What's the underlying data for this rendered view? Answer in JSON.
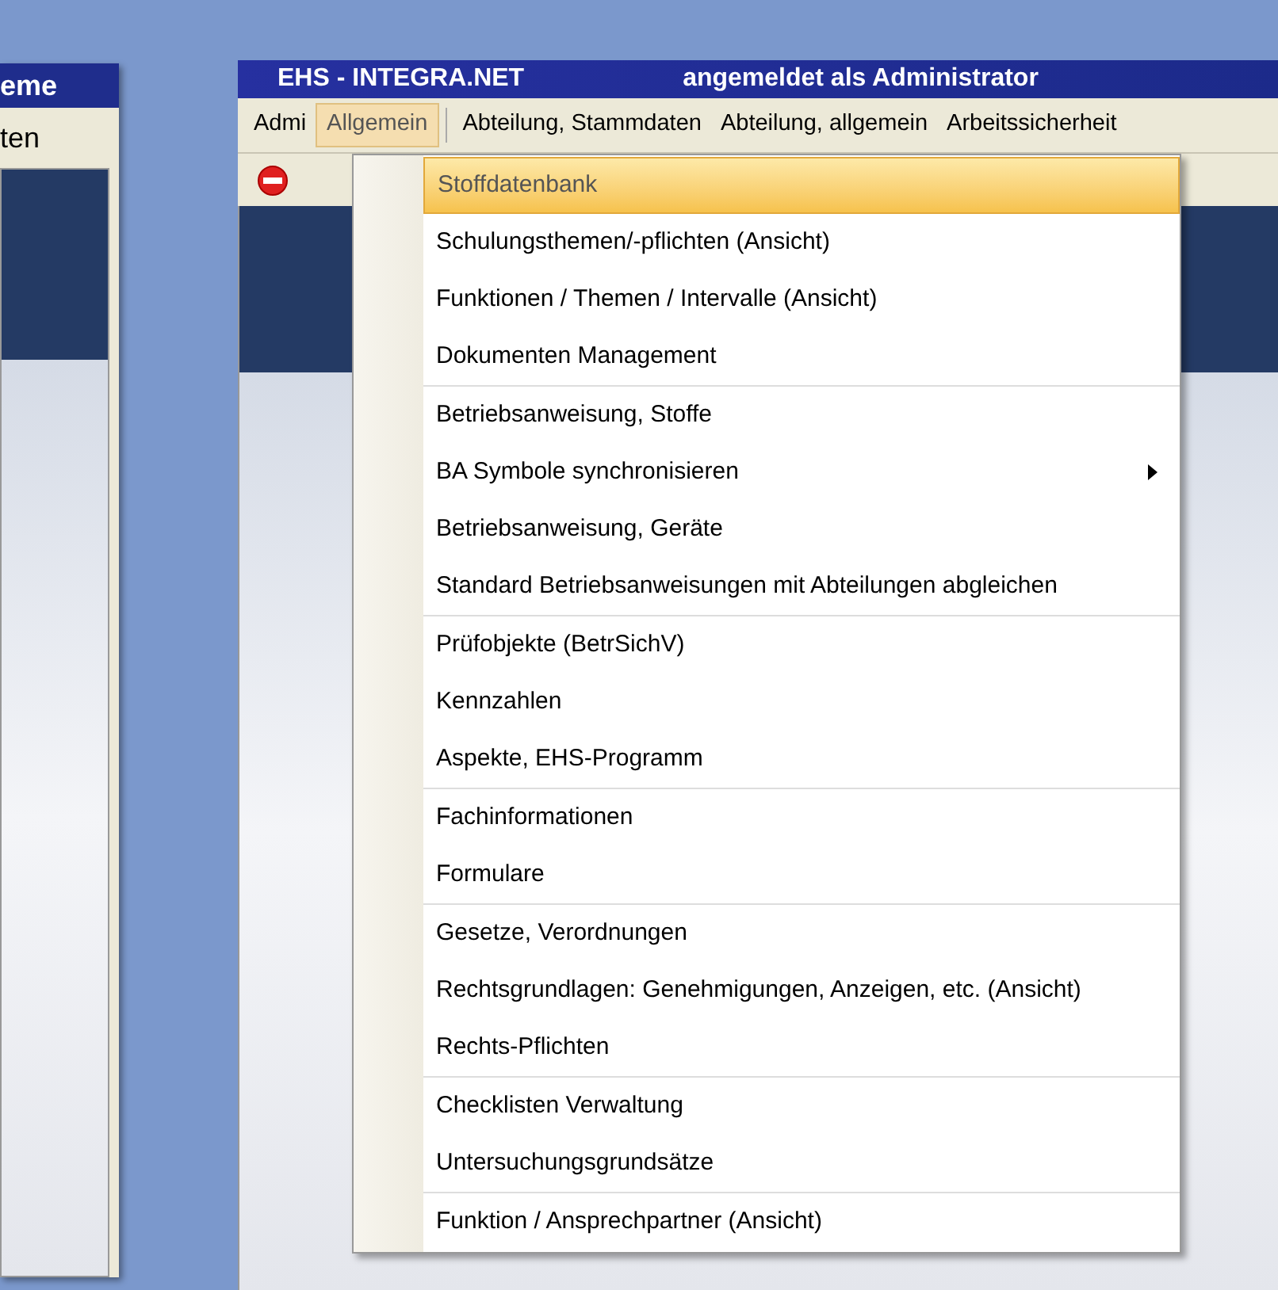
{
  "back_window": {
    "title": "eme",
    "menu_item": "ten"
  },
  "window": {
    "title": "EHS - INTEGRA.NET",
    "user": "angemeldet als Administrator"
  },
  "menubar": [
    {
      "label": "Admi",
      "selected": false
    },
    {
      "label": "Allgemein",
      "selected": true
    },
    {
      "label": "Abteilung, Stammdaten",
      "selected": false
    },
    {
      "label": "Abteilung, allgemein",
      "selected": false
    },
    {
      "label": "Arbeitssicherheit",
      "selected": false
    }
  ],
  "menu": {
    "groups": [
      [
        {
          "label": "Stoffdatenbank",
          "selected": true,
          "submenu": false
        },
        {
          "label": "Schulungsthemen/-pflichten (Ansicht)",
          "selected": false,
          "submenu": false
        },
        {
          "label": "Funktionen / Themen / Intervalle (Ansicht)",
          "selected": false,
          "submenu": false
        },
        {
          "label": "Dokumenten Management",
          "selected": false,
          "submenu": false
        }
      ],
      [
        {
          "label": "Betriebsanweisung, Stoffe",
          "selected": false,
          "submenu": false
        },
        {
          "label": "BA Symbole synchronisieren",
          "selected": false,
          "submenu": true
        },
        {
          "label": "Betriebsanweisung, Geräte",
          "selected": false,
          "submenu": false
        },
        {
          "label": "Standard Betriebsanweisungen mit Abteilungen abgleichen",
          "selected": false,
          "submenu": false
        }
      ],
      [
        {
          "label": "Prüfobjekte (BetrSichV)",
          "selected": false,
          "submenu": false
        },
        {
          "label": "Kennzahlen",
          "selected": false,
          "submenu": false
        },
        {
          "label": "Aspekte, EHS-Programm",
          "selected": false,
          "submenu": false
        }
      ],
      [
        {
          "label": "Fachinformationen",
          "selected": false,
          "submenu": false
        },
        {
          "label": "Formulare",
          "selected": false,
          "submenu": false
        }
      ],
      [
        {
          "label": "Gesetze, Verordnungen",
          "selected": false,
          "submenu": false
        },
        {
          "label": "Rechtsgrundlagen: Genehmigungen, Anzeigen, etc. (Ansicht)",
          "selected": false,
          "submenu": false
        },
        {
          "label": "Rechts-Pflichten",
          "selected": false,
          "submenu": false
        }
      ],
      [
        {
          "label": "Checklisten Verwaltung",
          "selected": false,
          "submenu": false
        },
        {
          "label": "Untersuchungsgrundsätze",
          "selected": false,
          "submenu": false
        }
      ],
      [
        {
          "label": "Funktion / Ansprechpartner (Ansicht)",
          "selected": false,
          "submenu": false
        }
      ]
    ]
  }
}
